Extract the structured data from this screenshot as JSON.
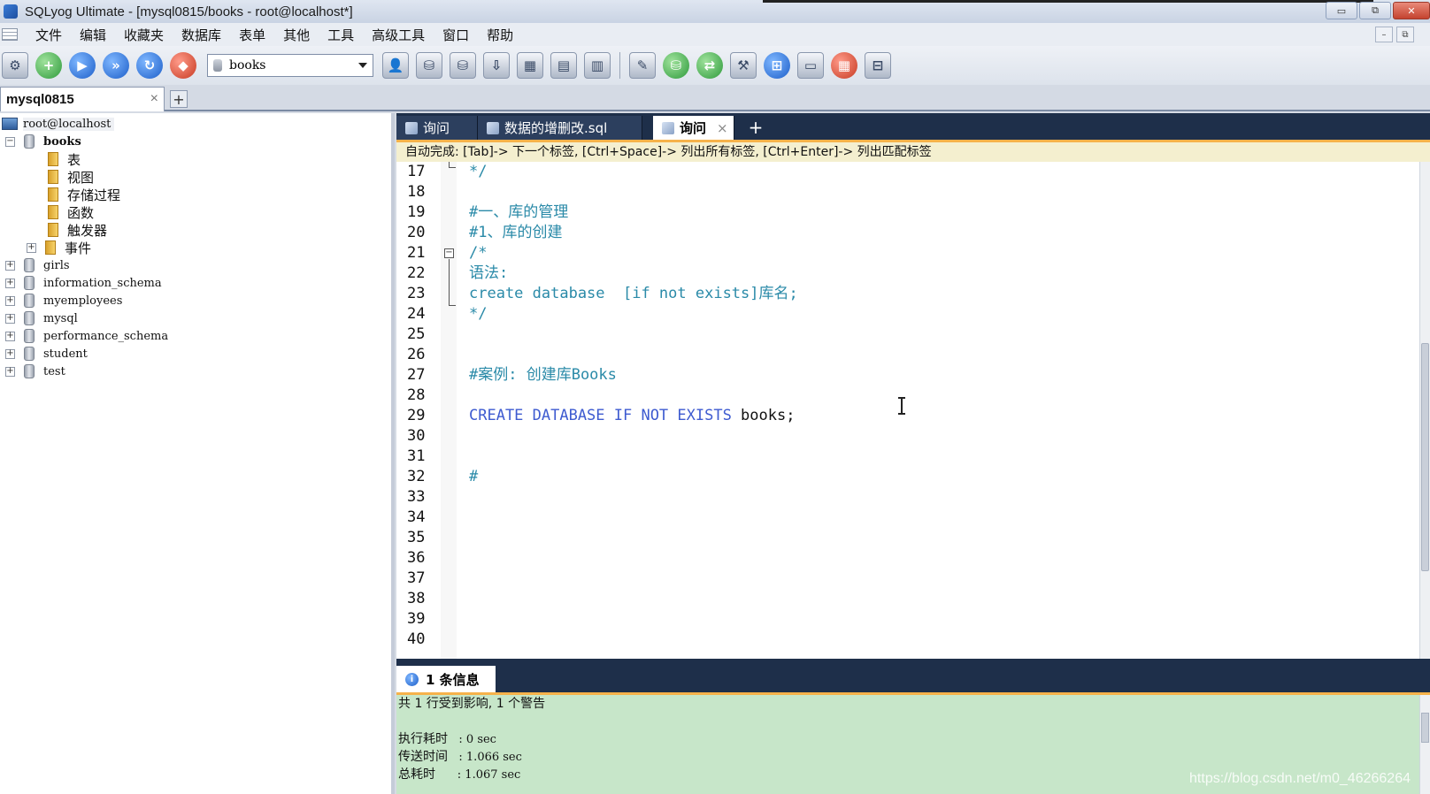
{
  "window": {
    "title": "SQLyog Ultimate - [mysql0815/books - root@localhost*]",
    "controls": [
      "▭",
      "⧉",
      "✕"
    ]
  },
  "menu": {
    "items": [
      "文件",
      "编辑",
      "收藏夹",
      "数据库",
      "表单",
      "其他",
      "工具",
      "高级工具",
      "窗口",
      "帮助"
    ],
    "right_controls": [
      "–",
      "⧉"
    ]
  },
  "toolbar": {
    "database_selected": "books",
    "icons": [
      "connect-icon",
      "new-connection-icon",
      "execute-query-icon",
      "execute-all-icon",
      "refresh-icon",
      "schema-icon",
      "user-icon",
      "backup-icon",
      "restore-icon",
      "import-icon",
      "table-icon",
      "table-data-icon",
      "column-icon",
      "sync-icon",
      "db-copy-icon",
      "migrate-icon",
      "schema-sync-icon",
      "visual-data-icon",
      "report-icon",
      "query-builder-icon",
      "schema-designer-icon"
    ]
  },
  "connection_tab": {
    "label": "mysql0815",
    "close": "×",
    "add": "+"
  },
  "tree": {
    "root": "root@localhost",
    "expanded_db": "books",
    "books_children": [
      "表",
      "视图",
      "存储过程",
      "函数",
      "触发器",
      "事件"
    ],
    "other_dbs": [
      "girls",
      "information_schema",
      "myemployees",
      "mysql",
      "performance_schema",
      "student",
      "test"
    ]
  },
  "editor_tabs": [
    {
      "label": "询问"
    },
    {
      "label": "数据的增删改.sql"
    },
    {
      "label": "询问",
      "close": "×"
    }
  ],
  "editor_tab_add": "+",
  "hint": "自动完成: [Tab]-> 下一个标签, [Ctrl+Space]-> 列出所有标签, [Ctrl+Enter]-> 列出匹配标签",
  "code": {
    "line_numbers": [
      "17",
      "18",
      "19",
      "20",
      "21",
      "22",
      "23",
      "24",
      "25",
      "26",
      "27",
      "28",
      "29",
      "30",
      "31",
      "32",
      "33",
      "34",
      "35",
      "36",
      "37",
      "38",
      "39",
      "40"
    ],
    "lines": {
      "l17": "*/",
      "l19": "#一、库的管理",
      "l20": "#1、库的创建",
      "l21": "/*",
      "l22": "语法:",
      "l23": "create database  [if not exists]库名;",
      "l24": "*/",
      "l27": "#案例: 创建库Books",
      "l29_kw": "CREATE DATABASE IF NOT EXISTS ",
      "l29_rest": "books;",
      "l32": "#"
    }
  },
  "messages": {
    "tab_label": "1 条信息",
    "summary": "共 1 行受到影响, 1 个警告",
    "exec_label": "执行耗时",
    "exec_value": "   : 0 sec",
    "transfer_label": "传送时间",
    "transfer_value": "   : 1.066 sec",
    "total_label": "总耗时",
    "total_value": "      : 1.067 sec"
  },
  "watermark": "https://blog.csdn.net/m0_46266264"
}
